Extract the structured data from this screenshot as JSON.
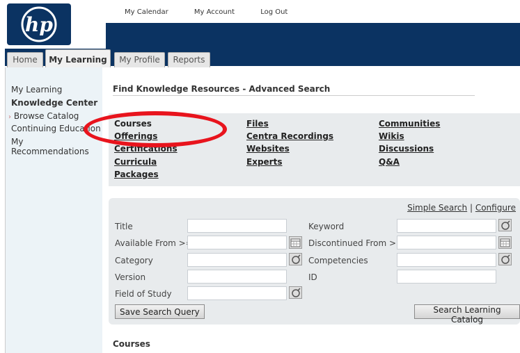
{
  "top_nav": [
    "My Calendar",
    "My Account",
    "Log Out"
  ],
  "logo_text": "hp",
  "tabs": [
    "Home",
    "My Learning",
    "My Profile",
    "Reports"
  ],
  "active_tab": "My Learning",
  "sidebar": {
    "items": [
      "My Learning",
      "Knowledge Center",
      "Browse Catalog",
      "Continuing Education",
      "My Recommendations"
    ],
    "bold_item": "Knowledge Center",
    "selected_marker": "›"
  },
  "page_title": "Find Knowledge Resources - Advanced Search",
  "resources": {
    "col1": [
      "Courses",
      "Offerings",
      "Certifications",
      "Curricula",
      "Packages"
    ],
    "col2": [
      "Files",
      "Centra Recordings",
      "Websites",
      "Experts"
    ],
    "col3": [
      "Communities",
      "Wikis",
      "Discussions",
      "Q&A"
    ]
  },
  "search": {
    "links": [
      "Simple Search",
      "Configure"
    ],
    "separator": "|",
    "fields_left": [
      "Title",
      "Available From >=",
      "Category",
      "Version",
      "Field of Study"
    ],
    "fields_right": [
      "Keyword",
      "Discontinued From >=",
      "Competencies",
      "ID"
    ],
    "save_button": "Save Search Query",
    "search_button": "Search Learning Catalog"
  },
  "results_label": "Courses",
  "colors": {
    "brand_blue": "#0b3362",
    "highlight": "#e8141d",
    "panel_gray": "#e8ebed",
    "sidebar_bg": "#ecf3f7"
  }
}
